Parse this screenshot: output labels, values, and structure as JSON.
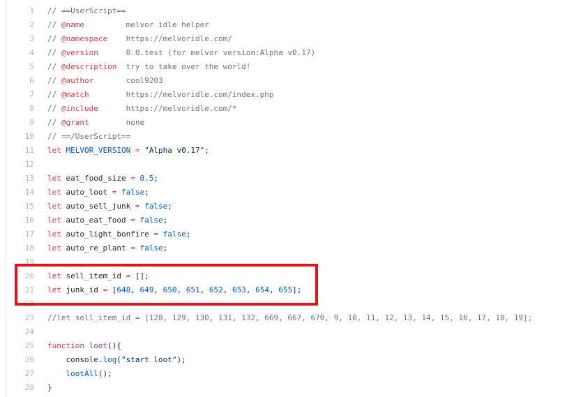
{
  "viewer": {
    "lines": [
      {
        "n": "1",
        "segments": [
          {
            "c": "c",
            "t": "// ==UserScript=="
          }
        ]
      },
      {
        "n": "2",
        "segments": [
          {
            "c": "c",
            "t": "// "
          },
          {
            "c": "tag",
            "t": "@name"
          },
          {
            "c": "c",
            "t": "         melvor idle helper"
          }
        ]
      },
      {
        "n": "3",
        "segments": [
          {
            "c": "c",
            "t": "// "
          },
          {
            "c": "tag",
            "t": "@namespace"
          },
          {
            "c": "c",
            "t": "    https://melvoridle.com/"
          }
        ]
      },
      {
        "n": "4",
        "segments": [
          {
            "c": "c",
            "t": "// "
          },
          {
            "c": "tag",
            "t": "@version"
          },
          {
            "c": "c",
            "t": "      0.0.test (for melvor version:Alpha v0.17)"
          }
        ]
      },
      {
        "n": "5",
        "segments": [
          {
            "c": "c",
            "t": "// "
          },
          {
            "c": "tag",
            "t": "@description"
          },
          {
            "c": "c",
            "t": "  try to take over the world!"
          }
        ]
      },
      {
        "n": "6",
        "segments": [
          {
            "c": "c",
            "t": "// "
          },
          {
            "c": "tag",
            "t": "@author"
          },
          {
            "c": "c",
            "t": "       cool9203"
          }
        ]
      },
      {
        "n": "7",
        "segments": [
          {
            "c": "c",
            "t": "// "
          },
          {
            "c": "tag",
            "t": "@match"
          },
          {
            "c": "c",
            "t": "        https://melvoridle.com/index.php"
          }
        ]
      },
      {
        "n": "8",
        "segments": [
          {
            "c": "c",
            "t": "// "
          },
          {
            "c": "tag",
            "t": "@include"
          },
          {
            "c": "c",
            "t": "      https://melvoridle.com/*"
          }
        ]
      },
      {
        "n": "9",
        "segments": [
          {
            "c": "c",
            "t": "// "
          },
          {
            "c": "tag",
            "t": "@grant"
          },
          {
            "c": "c",
            "t": "        none"
          }
        ]
      },
      {
        "n": "10",
        "segments": [
          {
            "c": "c",
            "t": "// ==/UserScript=="
          }
        ]
      },
      {
        "n": "11",
        "segments": [
          {
            "c": "k",
            "t": "let"
          },
          {
            "c": "",
            "t": " "
          },
          {
            "c": "v",
            "t": "MELVOR_VERSION"
          },
          {
            "c": "k",
            "t": " = "
          },
          {
            "c": "s",
            "t": "\"Alpha v0.17\""
          },
          {
            "c": "",
            "t": ";"
          }
        ]
      },
      {
        "n": "12",
        "segments": []
      },
      {
        "n": "13",
        "segments": [
          {
            "c": "k",
            "t": "let"
          },
          {
            "c": "",
            "t": " eat_food_size "
          },
          {
            "c": "k",
            "t": "="
          },
          {
            "c": "",
            "t": " "
          },
          {
            "c": "v",
            "t": "0.5"
          },
          {
            "c": "",
            "t": ";"
          }
        ]
      },
      {
        "n": "14",
        "segments": [
          {
            "c": "k",
            "t": "let"
          },
          {
            "c": "",
            "t": " auto_loot "
          },
          {
            "c": "k",
            "t": "="
          },
          {
            "c": "",
            "t": " "
          },
          {
            "c": "v",
            "t": "false"
          },
          {
            "c": "",
            "t": ";"
          }
        ]
      },
      {
        "n": "15",
        "segments": [
          {
            "c": "k",
            "t": "let"
          },
          {
            "c": "",
            "t": " auto_sell_junk "
          },
          {
            "c": "k",
            "t": "="
          },
          {
            "c": "",
            "t": " "
          },
          {
            "c": "v",
            "t": "false"
          },
          {
            "c": "",
            "t": ";"
          }
        ]
      },
      {
        "n": "16",
        "segments": [
          {
            "c": "k",
            "t": "let"
          },
          {
            "c": "",
            "t": " auto_eat_food "
          },
          {
            "c": "k",
            "t": "="
          },
          {
            "c": "",
            "t": " "
          },
          {
            "c": "v",
            "t": "false"
          },
          {
            "c": "",
            "t": ";"
          }
        ]
      },
      {
        "n": "17",
        "segments": [
          {
            "c": "k",
            "t": "let"
          },
          {
            "c": "",
            "t": " auto_light_bonfire "
          },
          {
            "c": "k",
            "t": "="
          },
          {
            "c": "",
            "t": " "
          },
          {
            "c": "v",
            "t": "false"
          },
          {
            "c": "",
            "t": ";"
          }
        ]
      },
      {
        "n": "18",
        "segments": [
          {
            "c": "k",
            "t": "let"
          },
          {
            "c": "",
            "t": " auto_re_plant "
          },
          {
            "c": "k",
            "t": "="
          },
          {
            "c": "",
            "t": " "
          },
          {
            "c": "v",
            "t": "false"
          },
          {
            "c": "",
            "t": ";"
          }
        ]
      },
      {
        "n": "19",
        "segments": []
      },
      {
        "n": "20",
        "segments": [
          {
            "c": "k",
            "t": "let"
          },
          {
            "c": "",
            "t": " sell_item_id "
          },
          {
            "c": "k",
            "t": "="
          },
          {
            "c": "",
            "t": " [];"
          }
        ]
      },
      {
        "n": "21",
        "segments": [
          {
            "c": "k",
            "t": "let"
          },
          {
            "c": "",
            "t": " junk_id "
          },
          {
            "c": "k",
            "t": "="
          },
          {
            "c": "",
            "t": " ["
          },
          {
            "c": "v",
            "t": "648"
          },
          {
            "c": "",
            "t": ", "
          },
          {
            "c": "v",
            "t": "649"
          },
          {
            "c": "",
            "t": ", "
          },
          {
            "c": "v",
            "t": "650"
          },
          {
            "c": "",
            "t": ", "
          },
          {
            "c": "v",
            "t": "651"
          },
          {
            "c": "",
            "t": ", "
          },
          {
            "c": "v",
            "t": "652"
          },
          {
            "c": "",
            "t": ", "
          },
          {
            "c": "v",
            "t": "653"
          },
          {
            "c": "",
            "t": ", "
          },
          {
            "c": "v",
            "t": "654"
          },
          {
            "c": "",
            "t": ", "
          },
          {
            "c": "v",
            "t": "655"
          },
          {
            "c": "",
            "t": "];"
          }
        ]
      },
      {
        "n": "22",
        "segments": []
      },
      {
        "n": "23",
        "segments": [
          {
            "c": "c",
            "t": "//let sell_item_id = [128, 129, 130, 131, 132, 669, 667, 670, 9, 10, 11, 12, 13, 14, 15, 16, 17, 18, 19];"
          }
        ]
      },
      {
        "n": "24",
        "segments": []
      },
      {
        "n": "25",
        "segments": [
          {
            "c": "k",
            "t": "function"
          },
          {
            "c": "",
            "t": " "
          },
          {
            "c": "f",
            "t": "loot"
          },
          {
            "c": "",
            "t": "(){"
          }
        ]
      },
      {
        "n": "26",
        "segments": [
          {
            "c": "",
            "t": "    console."
          },
          {
            "c": "v",
            "t": "log"
          },
          {
            "c": "",
            "t": "("
          },
          {
            "c": "s",
            "t": "\"start loot\""
          },
          {
            "c": "",
            "t": ");"
          }
        ]
      },
      {
        "n": "27",
        "segments": [
          {
            "c": "",
            "t": "    "
          },
          {
            "c": "v",
            "t": "lootAll"
          },
          {
            "c": "",
            "t": "();"
          }
        ]
      },
      {
        "n": "28",
        "segments": [
          {
            "c": "",
            "t": "}"
          }
        ]
      }
    ]
  },
  "colors": {
    "highlight_box": "#e0141b",
    "line_number": "#afb3b8",
    "comment": "#6a737d",
    "keyword": "#d73a49",
    "constant": "#005cc5",
    "string": "#032f62"
  }
}
